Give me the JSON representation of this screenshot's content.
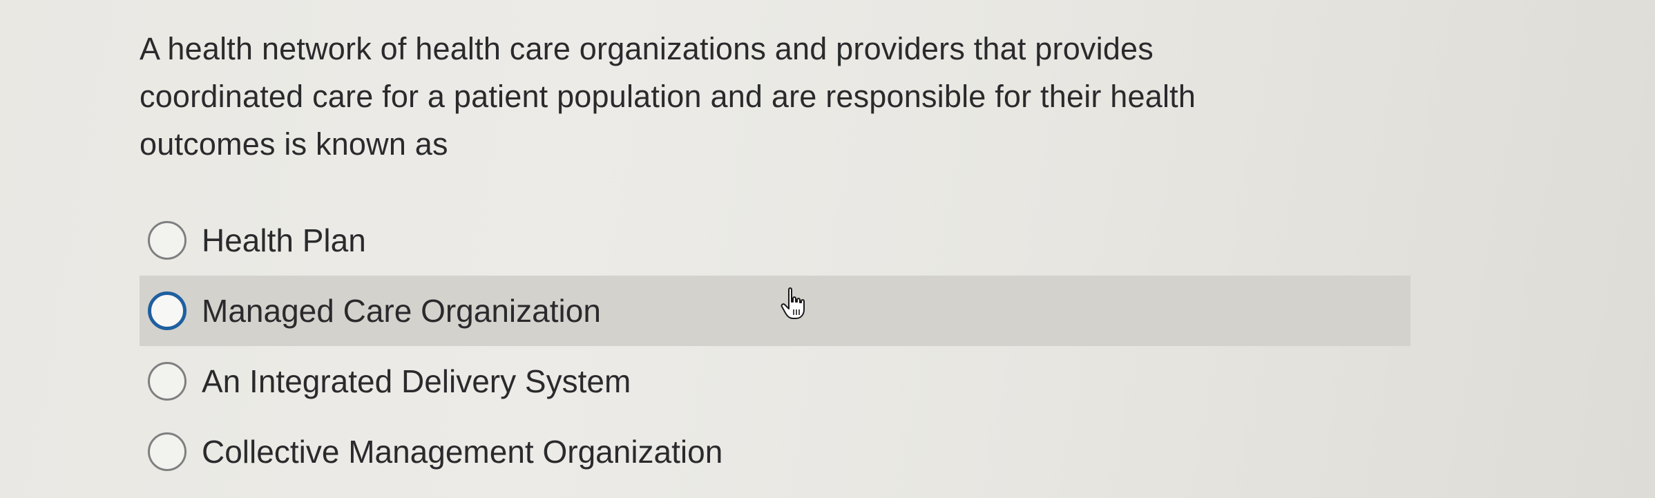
{
  "question": {
    "text": "A health network of health care organizations and providers that provides coordinated care for a patient population and are responsible for their health outcomes is known as"
  },
  "answers": [
    {
      "label": "Health Plan",
      "selected": false,
      "hovered": false
    },
    {
      "label": "Managed Care Organization",
      "selected": false,
      "hovered": true
    },
    {
      "label": "An Integrated Delivery System",
      "selected": false,
      "hovered": false
    },
    {
      "label": "Collective Management Organization",
      "selected": false,
      "hovered": false
    }
  ],
  "colors": {
    "hover_row": "#d3d2cd",
    "focus_ring": "#1e5fa0",
    "text": "#2a2a2c"
  },
  "cursor": {
    "icon": "hand-pointer-icon"
  }
}
